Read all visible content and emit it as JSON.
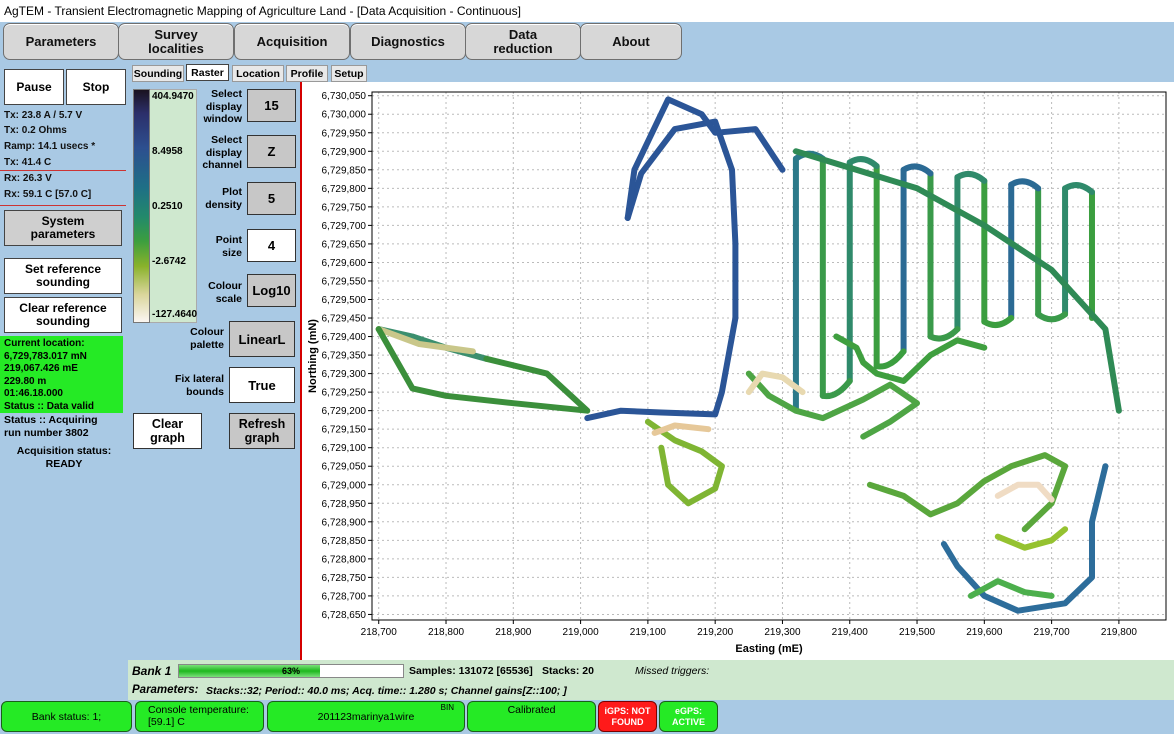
{
  "window": {
    "title": "AgTEM - Transient Electromagnetic Mapping of Agriculture Land - [Data Acquisition - Continuous]"
  },
  "top_buttons": [
    "Parameters",
    "Survey localities",
    "Acquisition",
    "Diagnostics",
    "Data reduction",
    "About"
  ],
  "left": {
    "pause": "Pause",
    "stop": "Stop",
    "tx_current": "Tx: 23.8 A / 5.7 V",
    "tx_ohms": "Tx: 0.2 Ohms",
    "ramp": "Ramp:  14.1 usecs *",
    "tx_temp": "Tx: 41.4 C",
    "rx_voltage": "Rx: 26.3 V",
    "rx_temp": "Rx: 59.1 C [57.0 C]",
    "system_parameters": "System parameters",
    "set_reference": "Set reference sounding",
    "clear_reference": "Clear reference sounding",
    "location": {
      "header": "Current location:",
      "northing": "6,729,783.017 mN",
      "easting": "219,067.426 mE",
      "altitude": "229.80 m",
      "time": "01:46.18.000",
      "status": "Status :: Data valid"
    },
    "status_line1": "Status :: Acquiring",
    "status_line2": "run number 3802",
    "acq_status_label": "Acquisition status:",
    "acq_status_value": "READY"
  },
  "tabs": [
    "Sounding",
    "Raster",
    "Location",
    "Profile",
    "Setup"
  ],
  "active_tab": "Raster",
  "colour_scale_labels": [
    "404.9470",
    "8.4958",
    "0.2510",
    "-2.6742",
    "-127.4640"
  ],
  "controls": {
    "select_window_label": "Select display window",
    "select_window_value": "15",
    "select_channel_label": "Select display channel",
    "select_channel_value": "Z",
    "plot_density_label": "Plot density",
    "plot_density_value": "5",
    "point_size_label": "Point size",
    "point_size_value": "4",
    "colour_scale_label": "Colour scale",
    "colour_scale_value": "Log10",
    "colour_palette_label": "Colour palette",
    "colour_palette_value": "LinearL",
    "fix_lateral_label": "Fix lateral bounds",
    "fix_lateral_value": "True",
    "clear_graph": "Clear graph",
    "refresh_graph": "Refresh graph"
  },
  "chart_data": {
    "type": "scatter",
    "xlabel": "Easting (mE)",
    "ylabel": "Northing (mN)",
    "x_ticks": [
      "218,700",
      "218,800",
      "218,900",
      "219,000",
      "219,100",
      "219,200",
      "219,300",
      "219,400",
      "219,500",
      "219,600",
      "219,700",
      "219,800"
    ],
    "y_ticks": [
      "6,730,050",
      "6,730,000",
      "6,729,950",
      "6,729,900",
      "6,729,850",
      "6,729,800",
      "6,729,750",
      "6,729,700",
      "6,729,650",
      "6,729,600",
      "6,729,550",
      "6,729,500",
      "6,729,450",
      "6,729,400",
      "6,729,350",
      "6,729,300",
      "6,729,250",
      "6,729,200",
      "6,729,150",
      "6,729,100",
      "6,729,050",
      "6,729,000",
      "6,728,950",
      "6,728,900",
      "6,728,850",
      "6,728,800",
      "6,728,750",
      "6,728,700",
      "6,728,650"
    ],
    "xlim": [
      218690,
      219870
    ],
    "ylim": [
      6728635,
      6730060
    ],
    "grid": true,
    "tracks": [
      {
        "color": "#2b5597",
        "points": [
          [
            219010,
            6729180
          ],
          [
            219060,
            6729200
          ],
          [
            219120,
            6729195
          ],
          [
            219200,
            6729190
          ],
          [
            219210,
            6729250
          ],
          [
            219230,
            6729450
          ],
          [
            219230,
            6729650
          ],
          [
            219225,
            6729850
          ],
          [
            219200,
            6729980
          ],
          [
            219140,
            6729960
          ],
          [
            219090,
            6729840
          ],
          [
            219070,
            6729720
          ]
        ]
      },
      {
        "color": "#2b5597",
        "points": [
          [
            219070,
            6729720
          ],
          [
            219080,
            6729850
          ],
          [
            219130,
            6730040
          ],
          [
            219180,
            6730000
          ],
          [
            219200,
            6729950
          ],
          [
            219260,
            6729960
          ],
          [
            219300,
            6729850
          ]
        ]
      },
      {
        "color": "#3b8f6e",
        "points": [
          [
            218700,
            6729420
          ],
          [
            218750,
            6729400
          ],
          [
            218800,
            6729370
          ],
          [
            218860,
            6729340
          ]
        ]
      },
      {
        "color": "#c9c78a",
        "points": [
          [
            218700,
            6729420
          ],
          [
            218760,
            6729380
          ],
          [
            218840,
            6729360
          ]
        ]
      },
      {
        "color": "#3b8f3b",
        "points": [
          [
            218860,
            6729340
          ],
          [
            218950,
            6729300
          ],
          [
            219010,
            6729200
          ],
          [
            218900,
            6729220
          ],
          [
            218800,
            6729240
          ],
          [
            218750,
            6729260
          ],
          [
            218700,
            6729420
          ]
        ]
      },
      {
        "color": "#2f8a55",
        "points": [
          [
            219320,
            6729900
          ],
          [
            219500,
            6729800
          ],
          [
            219600,
            6729700
          ],
          [
            219700,
            6729580
          ],
          [
            219780,
            6729420
          ],
          [
            219800,
            6729200
          ]
        ]
      },
      {
        "color": "#3f9f3f",
        "points": [
          [
            219380,
            6729400
          ],
          [
            219410,
            6729370
          ],
          [
            219420,
            6729330
          ],
          [
            219440,
            6729300
          ],
          [
            219480,
            6729280
          ],
          [
            219520,
            6729350
          ],
          [
            219560,
            6729390
          ],
          [
            219600,
            6729370
          ]
        ]
      },
      {
        "color": "#7fb533",
        "points": [
          [
            219100,
            6729170
          ],
          [
            219140,
            6729120
          ],
          [
            219180,
            6729090
          ],
          [
            219210,
            6729050
          ],
          [
            219200,
            6728990
          ],
          [
            219160,
            6728950
          ],
          [
            219130,
            6729000
          ],
          [
            219120,
            6729100
          ]
        ]
      },
      {
        "color": "#4ea545",
        "points": [
          [
            219250,
            6729300
          ],
          [
            219280,
            6729240
          ],
          [
            219320,
            6729200
          ],
          [
            219360,
            6729180
          ],
          [
            219420,
            6729230
          ],
          [
            219460,
            6729270
          ],
          [
            219500,
            6729220
          ],
          [
            219460,
            6729170
          ],
          [
            219420,
            6729130
          ]
        ]
      },
      {
        "color": "#e8d9b0",
        "points": [
          [
            219250,
            6729250
          ],
          [
            219270,
            6729300
          ],
          [
            219300,
            6729290
          ],
          [
            219330,
            6729250
          ]
        ]
      },
      {
        "color": "#2d6d9b",
        "points": [
          [
            219540,
            6728840
          ],
          [
            219560,
            6728780
          ],
          [
            219600,
            6728700
          ],
          [
            219650,
            6728660
          ],
          [
            219720,
            6728680
          ],
          [
            219760,
            6728750
          ],
          [
            219760,
            6728900
          ],
          [
            219780,
            6729050
          ]
        ]
      },
      {
        "color": "#5aa73c",
        "points": [
          [
            219430,
            6729000
          ],
          [
            219480,
            6728970
          ],
          [
            219520,
            6728920
          ],
          [
            219560,
            6728950
          ],
          [
            219600,
            6729010
          ],
          [
            219640,
            6729050
          ],
          [
            219690,
            6729080
          ],
          [
            219720,
            6729050
          ],
          [
            219700,
            6728950
          ],
          [
            219660,
            6728880
          ]
        ]
      },
      {
        "color": "#f0dcc4",
        "points": [
          [
            219620,
            6728970
          ],
          [
            219650,
            6729000
          ],
          [
            219680,
            6729000
          ],
          [
            219700,
            6728960
          ]
        ]
      },
      {
        "color": "#95c230",
        "points": [
          [
            219620,
            6728860
          ],
          [
            219660,
            6728830
          ],
          [
            219700,
            6728850
          ],
          [
            219720,
            6728880
          ]
        ]
      },
      {
        "color": "#4caf4c",
        "points": [
          [
            219580,
            6728700
          ],
          [
            219620,
            6728740
          ],
          [
            219660,
            6728710
          ],
          [
            219700,
            6728700
          ]
        ]
      },
      {
        "color": "#e6c899",
        "points": [
          [
            219110,
            6729140
          ],
          [
            219140,
            6729160
          ],
          [
            219190,
            6729150
          ]
        ]
      }
    ],
    "lanes": [
      {
        "x": 219320,
        "y_top": 6729880,
        "y_bottom": 6729200,
        "color": "#2c7a8a"
      },
      {
        "x": 219360,
        "y_top": 6729880,
        "y_bottom": 6729240,
        "color": "#3a9a4a"
      },
      {
        "x": 219400,
        "y_top": 6729870,
        "y_bottom": 6729280,
        "color": "#2f8a6b"
      },
      {
        "x": 219440,
        "y_top": 6729860,
        "y_bottom": 6729320,
        "color": "#3b9e3f"
      },
      {
        "x": 219480,
        "y_top": 6729850,
        "y_bottom": 6729360,
        "color": "#2b6a94"
      },
      {
        "x": 219520,
        "y_top": 6729840,
        "y_bottom": 6729400,
        "color": "#3a9a4a"
      },
      {
        "x": 219560,
        "y_top": 6729830,
        "y_bottom": 6729420,
        "color": "#2f8a6b"
      },
      {
        "x": 219600,
        "y_top": 6729820,
        "y_bottom": 6729440,
        "color": "#3b9e3f"
      },
      {
        "x": 219640,
        "y_top": 6729810,
        "y_bottom": 6729450,
        "color": "#2b6a94"
      },
      {
        "x": 219680,
        "y_top": 6729800,
        "y_bottom": 6729460,
        "color": "#3a9a4a"
      },
      {
        "x": 219720,
        "y_top": 6729800,
        "y_bottom": 6729460,
        "color": "#2f8a6b"
      },
      {
        "x": 219760,
        "y_top": 6729790,
        "y_bottom": 6729450,
        "color": "#3b9e3f"
      }
    ]
  },
  "bank": {
    "label": "Bank 1",
    "progress": 63,
    "progress_text": "63%",
    "samples": "Samples:  131072 [65536]",
    "stacks": "Stacks: 20",
    "missed": "Missed triggers:"
  },
  "parameters_row": {
    "label": "Parameters:",
    "text": "Stacks::32; Period:: 40.0 ms; Acq. time:: 1.280 s; Channel gains[Z::100; ]"
  },
  "status_bar": {
    "bank_status": "Bank status: 1;",
    "console_temp_label": "Console temperature:",
    "console_temp_value": "[59.1] C",
    "filename": "201123marinya1wire",
    "bin": "BIN",
    "calibrated": "Calibrated",
    "igps": "iGPS: NOT FOUND",
    "egps": "eGPS: ACTIVE"
  },
  "colors": {
    "ok": "#25ea25",
    "error": "#ff1a1a",
    "panel": "#a9c9e4",
    "red_axis": "#d40000"
  }
}
